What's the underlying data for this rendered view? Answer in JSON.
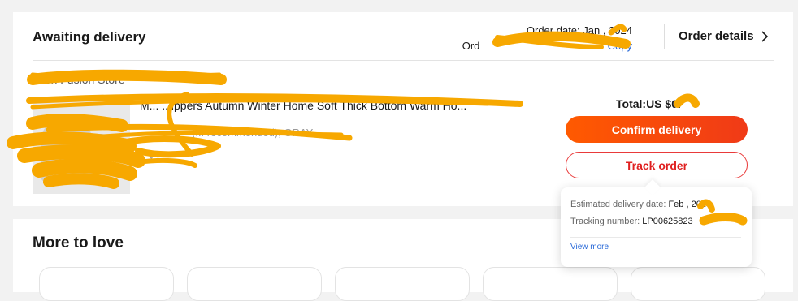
{
  "order": {
    "status": "Awaiting delivery",
    "date_label": "Order date:",
    "date_value": "Jan , 2024",
    "id_label": "Ord",
    "copy_label": "Copy",
    "details_label": "Order details"
  },
  "store": {
    "name": "...ion Fusion Store"
  },
  "product": {
    "title": "M... ...ippers Autumn Winter Home Soft Thick Bottom Warm Ho...",
    "variant": "(... recommended), GRAY",
    "qty": "X1"
  },
  "summary": {
    "total": "Total:US $0.",
    "confirm_label": "Confirm delivery",
    "track_label": "Track order"
  },
  "tracking_popover": {
    "eta_label": "Estimated delivery date:",
    "eta_value": "Feb , 2024",
    "tracking_label": "Tracking number:",
    "tracking_value": "LP00625823",
    "view_more": "View more"
  },
  "recommendations": {
    "title": "More to love"
  },
  "colors": {
    "accent": "#fd384f",
    "confirm_gradient_start": "#ff5a00",
    "confirm_gradient_end": "#f03a17",
    "link": "#2a6ad8",
    "redaction": "#f7a800"
  }
}
